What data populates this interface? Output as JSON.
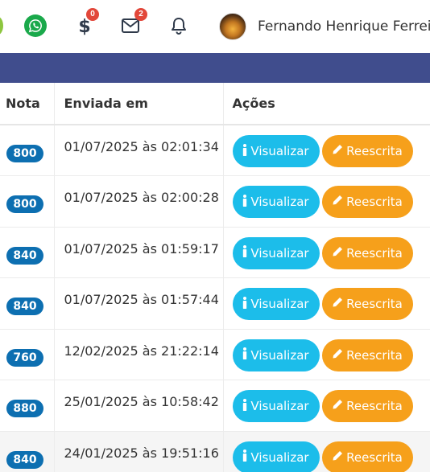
{
  "header": {
    "money_badge": "0",
    "mail_badge": "2",
    "user_name": "Fernando Henrique Ferreira"
  },
  "table": {
    "columns": [
      "Nota",
      "Enviada em",
      "Ações"
    ],
    "view_label": "Visualizar",
    "rewrite_label": "Reescrita",
    "rows": [
      {
        "grade": "800",
        "sent": "01/07/2025 às 02:01:34"
      },
      {
        "grade": "800",
        "sent": "01/07/2025 às 02:00:28"
      },
      {
        "grade": "840",
        "sent": "01/07/2025 às 01:59:17"
      },
      {
        "grade": "840",
        "sent": "01/07/2025 às 01:57:44"
      },
      {
        "grade": "760",
        "sent": "12/02/2025 às 21:22:14"
      },
      {
        "grade": "880",
        "sent": "25/01/2025 às 10:58:42"
      },
      {
        "grade": "840",
        "sent": "24/01/2025 às 19:51:16"
      }
    ]
  },
  "colors": {
    "navbar": "#404d8d",
    "grade_badge": "#0d6fb1",
    "view_button": "#1cbdea",
    "rewrite_button": "#f6a01b",
    "notification_badge": "#e2473a"
  }
}
